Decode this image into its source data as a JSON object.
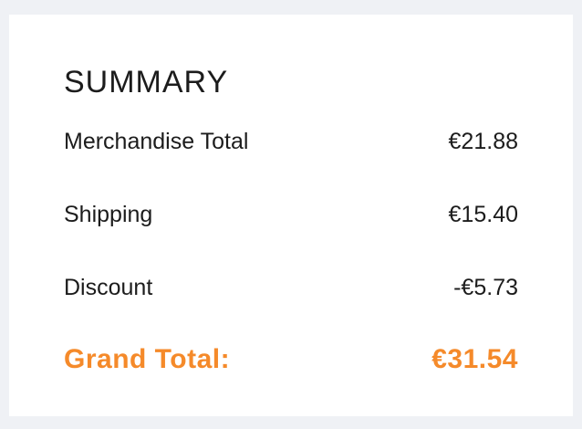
{
  "summary": {
    "title": "SUMMARY",
    "merchandise_label": "Merchandise Total",
    "merchandise_value": "€21.88",
    "shipping_label": "Shipping",
    "shipping_value": "€15.40",
    "discount_label": "Discount",
    "discount_value": "-€5.73",
    "grand_total_label": "Grand Total:",
    "grand_total_value": "€31.54",
    "accent_color": "#f58a2a"
  }
}
